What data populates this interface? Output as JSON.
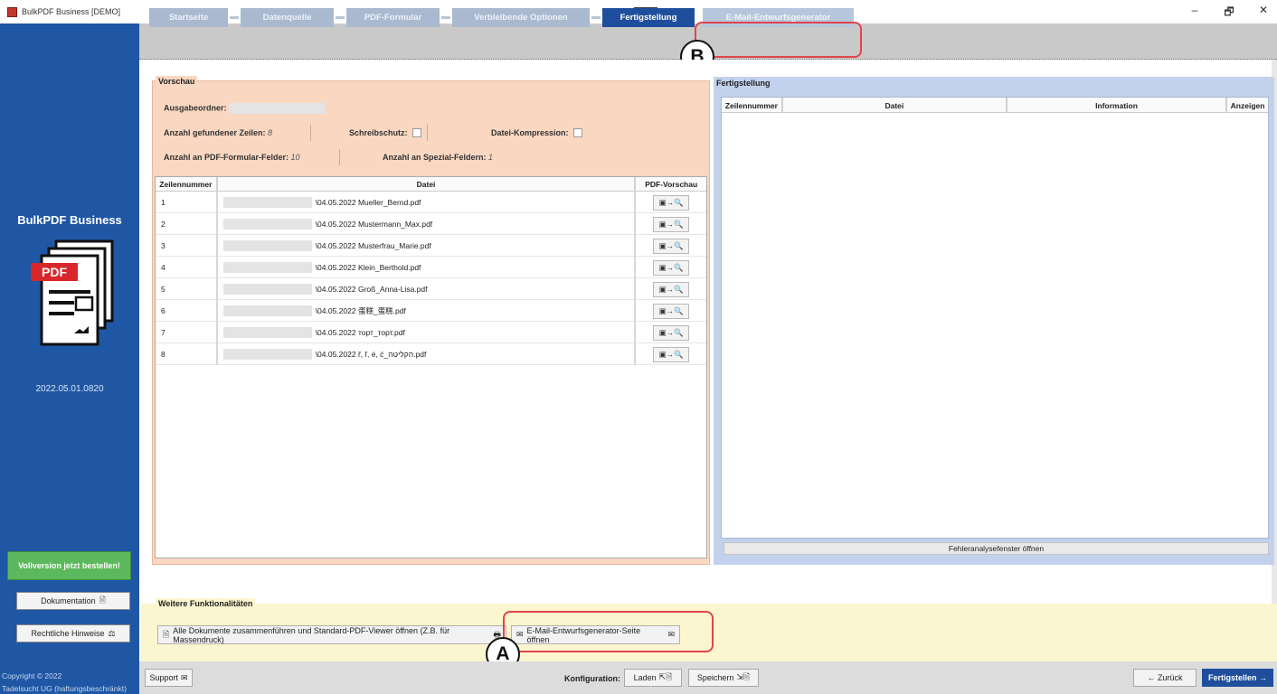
{
  "window": {
    "title": "BulkPDF Business [DEMO]",
    "minimize_glyph": "–",
    "maximize_glyph": "🗗",
    "close_glyph": "✕"
  },
  "sidebar": {
    "brand": "BulkPDF Business",
    "pdf_label": "PDF",
    "version": "2022.05.01.0820",
    "order_button": "Vollversion jetzt bestellen!",
    "doc_button": "Dokumentation",
    "legal_button": "Rechtliche Hinweise",
    "copyright_line1": "Copyright © 2022",
    "copyright_line2": "Tadelsucht UG (haftungsbeschränkt)"
  },
  "steps": [
    {
      "label": "Startseite"
    },
    {
      "label": "Datenquelle"
    },
    {
      "label": "PDF-Formular"
    },
    {
      "label": "Verbleibende Optionen"
    },
    {
      "label": "Fertigstellung"
    },
    {
      "label": "E-Mail-Entwurfsgenerator"
    }
  ],
  "callouts": {
    "a": "A",
    "b": "B"
  },
  "preview": {
    "title": "Vorschau",
    "output_folder_label": "Ausgabeordner:",
    "rows_found_label": "Anzahl gefundener Zeilen:",
    "rows_found_value": "8",
    "write_protect_label": "Schreibschutz:",
    "compression_label": "Datei-Kompression:",
    "form_fields_label": "Anzahl an PDF-Formular-Felder:",
    "form_fields_value": "10",
    "special_fields_label": "Anzahl an Spezial-Feldern:",
    "special_fields_value": "1",
    "columns": [
      "Zeilennummer",
      "Datei",
      "PDF-Vorschau"
    ],
    "preview_glyph": "▣→🔍",
    "rows": [
      {
        "num": "1",
        "file": "\\04.05.2022 Mueller_Bernd.pdf"
      },
      {
        "num": "2",
        "file": "\\04.05.2022 Mustermann_Max.pdf"
      },
      {
        "num": "3",
        "file": "\\04.05.2022 Musterfrau_Marie.pdf"
      },
      {
        "num": "4",
        "file": "\\04.05.2022 Klein_Berthold.pdf"
      },
      {
        "num": "5",
        "file": "\\04.05.2022 Groß_Anna-Lisa.pdf"
      },
      {
        "num": "6",
        "file": "\\04.05.2022 蛋糕_蛋糕.pdf"
      },
      {
        "num": "7",
        "file": "\\04.05.2022 торт_торт.pdf"
      },
      {
        "num": "8",
        "file": "\\04.05.2022 ř, ľ, ė, ć_הקליטה.pdf"
      }
    ]
  },
  "finish": {
    "title": "Fertigstellung",
    "columns": [
      "Zeilennummer",
      "Datei",
      "Information",
      "Anzeigen"
    ],
    "error_button": "Fehleranalysefenster öffnen"
  },
  "further": {
    "title": "Weitere Funktionalitäten",
    "merge_button": "Alle Dokumente zusammenführen und Standard-PDF-Viewer öffnen (Z.B. für Massendruck)",
    "email_button": "E-Mail-Entwurfsgenerator-Seite öffnen"
  },
  "bottom": {
    "support": "Support",
    "config_label": "Konfiguration:",
    "load": "Laden",
    "save": "Speichern",
    "back": "← Zurück",
    "finish": "Fertigstellen →"
  }
}
